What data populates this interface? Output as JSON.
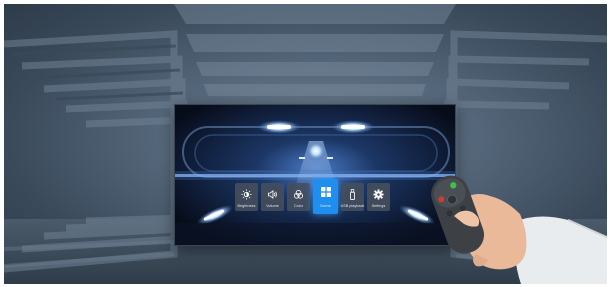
{
  "menu": {
    "items": [
      {
        "label": "Brightness",
        "icon": "brightness-icon"
      },
      {
        "label": "Volume",
        "icon": "volume-icon"
      },
      {
        "label": "Color",
        "icon": "color-icon"
      },
      {
        "label": "Scene",
        "icon": "scene-icon",
        "active": true
      },
      {
        "label": "USB playback",
        "icon": "usb-icon"
      },
      {
        "label": "Settings",
        "icon": "settings-icon"
      }
    ]
  },
  "colors": {
    "accent": "#1e8ff0",
    "tile": "#464e5c",
    "screen_bg": "#0a1020",
    "wall": "#55677a"
  }
}
